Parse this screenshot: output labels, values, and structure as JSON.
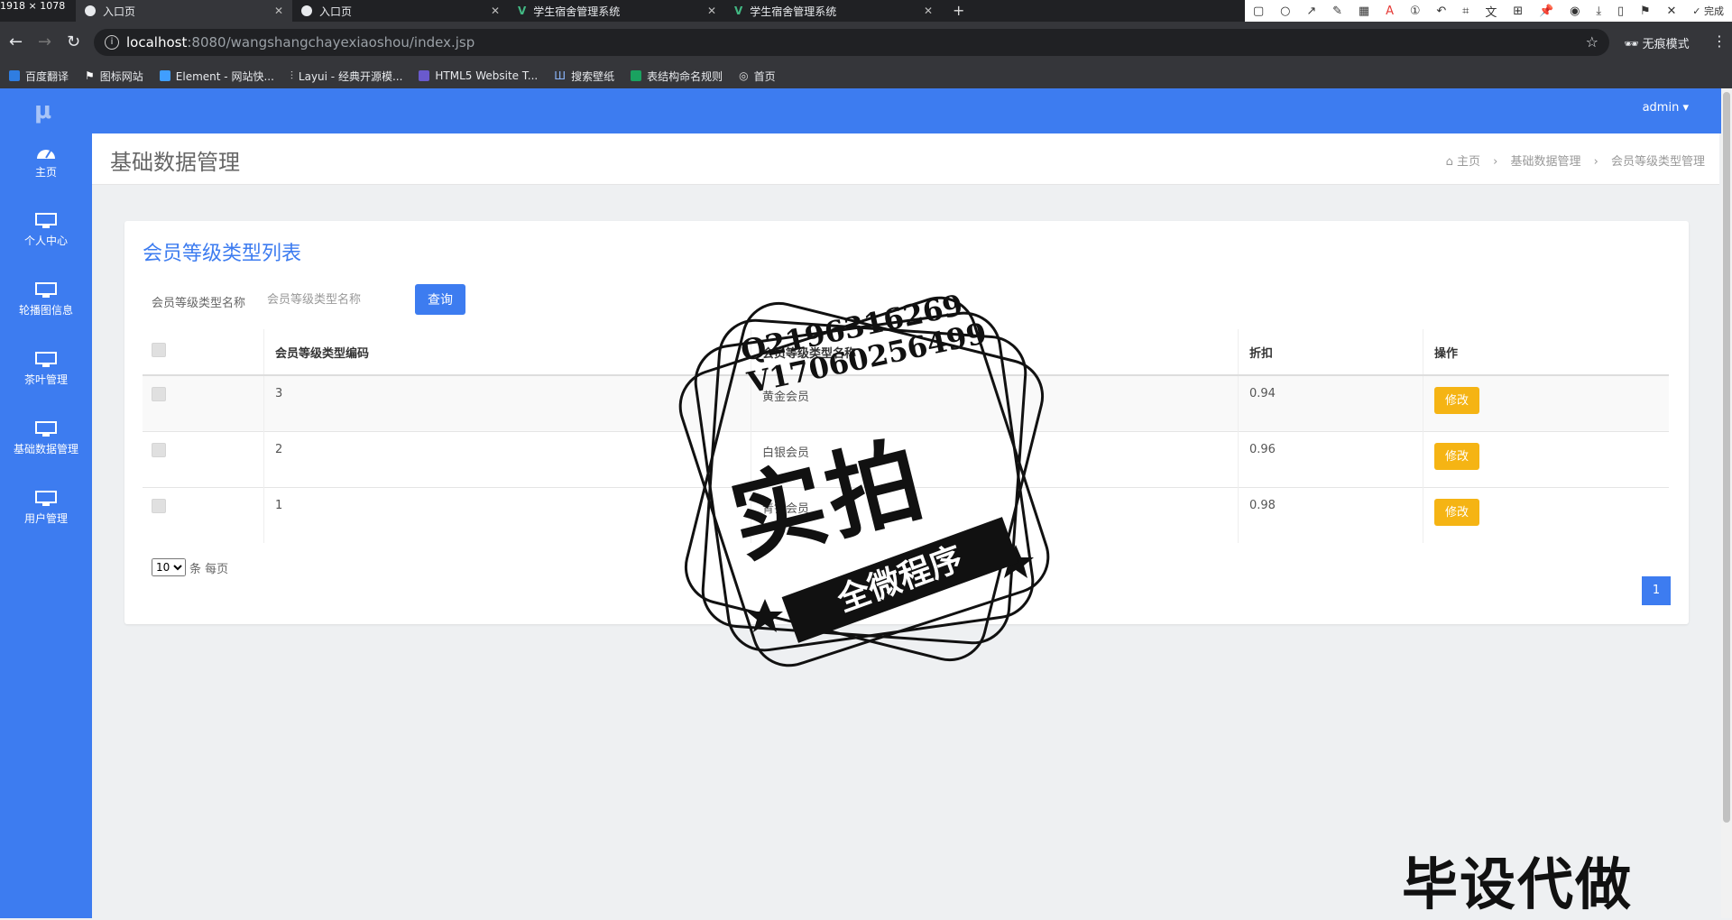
{
  "screen_size_label": "1918 × 1078",
  "tabs": [
    {
      "title": "入口页",
      "icon": "globe-icon"
    },
    {
      "title": "入口页",
      "icon": "globe-icon"
    },
    {
      "title": "学生宿舍管理系统",
      "icon": "vue-icon"
    },
    {
      "title": "学生宿舍管理系统",
      "icon": "vue-icon"
    }
  ],
  "toolbar": {
    "done_label": "完成"
  },
  "address": {
    "host": "localhost",
    "path": ":8080/wangshangchayexiaoshou/index.jsp"
  },
  "incognito_label": "无痕模式",
  "bookmarks": [
    "百度翻译",
    "图标网站",
    "Element - 网站快...",
    "Layui - 经典开源模...",
    "HTML5 Website T...",
    "搜索壁纸",
    "表结构命名规则",
    "首页"
  ],
  "sidebar": {
    "items": [
      {
        "label": "主页",
        "icon": "dashboard-icon"
      },
      {
        "label": "个人中心",
        "icon": "monitor-icon"
      },
      {
        "label": "轮播图信息",
        "icon": "monitor-icon"
      },
      {
        "label": "茶叶管理",
        "icon": "monitor-icon"
      },
      {
        "label": "基础数据管理",
        "icon": "monitor-icon"
      },
      {
        "label": "用户管理",
        "icon": "monitor-icon"
      }
    ]
  },
  "topbar": {
    "user": "admin"
  },
  "header": {
    "title": "基础数据管理",
    "breadcrumb": [
      "主页",
      "基础数据管理",
      "会员等级类型管理"
    ]
  },
  "panel": {
    "title": "会员等级类型列表",
    "search_label": "会员等级类型名称",
    "search_placeholder": "会员等级类型名称",
    "query_button": "查询",
    "columns": [
      "会员等级类型编码",
      "会员等级类型名称",
      "折扣",
      "操作"
    ],
    "rows": [
      {
        "code": "3",
        "name": "黄金会员",
        "discount": "0.94",
        "action": "修改"
      },
      {
        "code": "2",
        "name": "白银会员",
        "discount": "0.96",
        "action": "修改"
      },
      {
        "code": "1",
        "name": "青铜会员",
        "discount": "0.98",
        "action": "修改"
      }
    ],
    "page_size": "10",
    "page_size_suffix": "条 每页",
    "current_page": "1"
  },
  "watermark": {
    "qq": "Q2196316269",
    "vx": "V17060256499",
    "big": "实拍",
    "ribbon": "全微程序",
    "bottom": "毕设代做"
  },
  "colors": {
    "primary": "#3d7cf0",
    "warning": "#f5b414"
  }
}
